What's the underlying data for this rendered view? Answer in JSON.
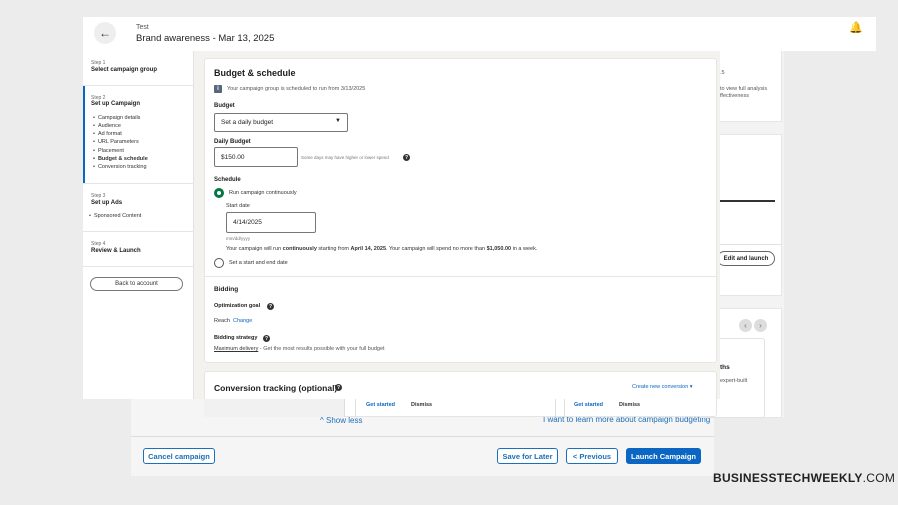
{
  "header": {
    "subtitle": "Test",
    "title": "Brand awareness - Mar 13, 2025",
    "back_icon": "arrow-left-icon",
    "bell_icon": "bell-icon"
  },
  "sidebar": {
    "step1": {
      "step": "Step 1",
      "title": "Select campaign group"
    },
    "step2": {
      "step": "Step 2",
      "title": "Set up Campaign",
      "items": [
        "Campaign details",
        "Audience",
        "Ad format",
        "URL Parameters",
        "Placement",
        "Budget & schedule",
        "Conversion tracking"
      ]
    },
    "step3": {
      "step": "Step 3",
      "title": "Set up Ads",
      "items": [
        "Sponsored Content"
      ]
    },
    "step4": {
      "step": "Step 4",
      "title": "Review & Launch"
    },
    "back_label": "Back to account"
  },
  "budget": {
    "heading": "Budget & schedule",
    "info": "Your campaign group is scheduled to run from 3/13/2025",
    "budget_label": "Budget",
    "budget_type": "Set a daily budget",
    "daily_label": "Daily Budget",
    "daily_value": "$150.00",
    "daily_hint": "Some days may have higher or lower spend",
    "schedule_label": "Schedule",
    "run_continuous": "Run campaign continuously",
    "start_label": "Start date",
    "start_value": "4/14/2025",
    "date_format": "mm/dd/yyyy",
    "summary_pre": "Your campaign will run ",
    "summary_b1": "continuously",
    "summary_mid": " starting from ",
    "summary_b2": "April 14, 2025",
    "summary_mid2": ". Your campaign will spend no more than ",
    "summary_b3": "$1,050.00",
    "summary_post": " in a week.",
    "start_end": "Set a start and end date"
  },
  "bidding": {
    "heading": "Bidding",
    "goal_label": "Optimization goal",
    "goal_value": "Reach",
    "change": "Change",
    "strategy_label": "Bidding strategy",
    "strategy_value": "Maximum delivery",
    "strategy_desc": " - Get the most results possible with your full budget"
  },
  "conversion": {
    "heading": "Conversion tracking (optional)",
    "create": "Create new conversion",
    "get_started": "Get started",
    "dismiss": "Dismiss"
  },
  "right_panel": {
    "text1": "to view full analysis",
    "text2": "ffectiveness",
    "text3": ".5",
    "edit_launch": "Edit and launch",
    "text4": "ths",
    "text5": "expert-built"
  },
  "footer": {
    "show_less": "^ Show less",
    "learn_more": "I want to learn more about campaign budgeting",
    "cancel": "Cancel campaign",
    "save": "Save for Later",
    "previous": "< Previous",
    "launch": "Launch Campaign"
  },
  "watermark": {
    "bold": "BUSINESSTECHWEEKLY",
    "rest": ".COM"
  }
}
